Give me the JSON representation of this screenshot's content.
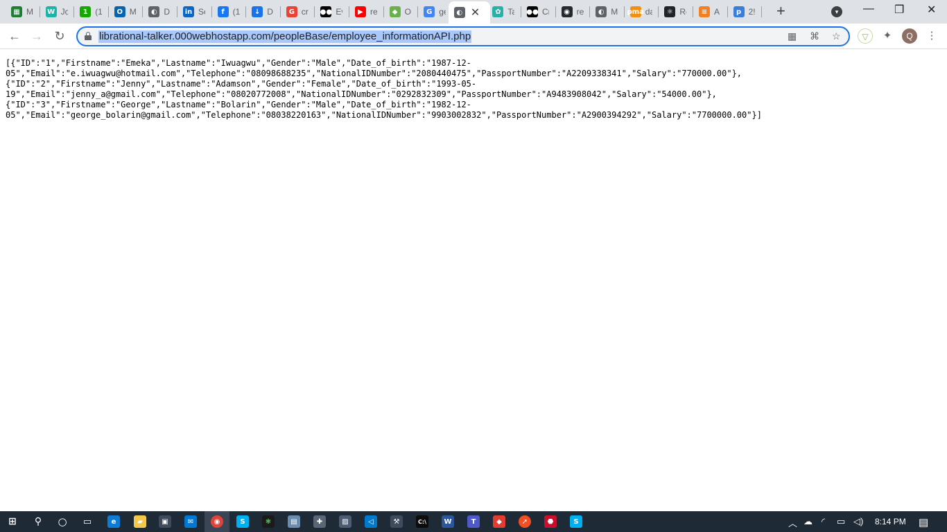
{
  "browser": {
    "tabs": [
      {
        "label": "M",
        "icon": "sheets-icon",
        "color": "#1e7e34",
        "glyph": "▦"
      },
      {
        "label": "Jc",
        "icon": "workana-icon",
        "color": "#1fb3a8",
        "glyph": "W"
      },
      {
        "label": "(1",
        "icon": "upwork-icon",
        "color": "#14a800",
        "glyph": "1"
      },
      {
        "label": "M",
        "icon": "outlook-icon",
        "color": "#0a64ad",
        "glyph": "O"
      },
      {
        "label": "D",
        "icon": "globe-icon",
        "color": "#5f6368",
        "glyph": "◐"
      },
      {
        "label": "Se",
        "icon": "linkedin-icon",
        "color": "#0a66c2",
        "glyph": "in"
      },
      {
        "label": "(1",
        "icon": "facebook-icon",
        "color": "#1877f2",
        "glyph": "f"
      },
      {
        "label": "D",
        "icon": "download-icon",
        "color": "#1a73e8",
        "glyph": "↓"
      },
      {
        "label": "cr",
        "icon": "google-icon",
        "color": "#ea4335",
        "glyph": "G"
      },
      {
        "label": "Ev",
        "icon": "medium-icon",
        "color": "#000000",
        "glyph": "●●"
      },
      {
        "label": "re",
        "icon": "youtube-icon",
        "color": "#ff0000",
        "glyph": "▶"
      },
      {
        "label": "O",
        "icon": "android-icon",
        "color": "#6ab04c",
        "glyph": "◆"
      },
      {
        "label": "ge",
        "icon": "google-icon",
        "color": "#4285f4",
        "glyph": "G"
      },
      {
        "label": "",
        "icon": "globe-icon",
        "color": "#5f6368",
        "glyph": "◐",
        "active": true
      },
      {
        "label": "Ta",
        "icon": "tailwind-icon",
        "color": "#2bb0a8",
        "glyph": "✿"
      },
      {
        "label": "Cr",
        "icon": "medium-icon",
        "color": "#000000",
        "glyph": "●●"
      },
      {
        "label": "re",
        "icon": "github-icon",
        "color": "#24292e",
        "glyph": "◉"
      },
      {
        "label": "M",
        "icon": "globe-icon",
        "color": "#5f6368",
        "glyph": "◐"
      },
      {
        "label": "da",
        "icon": "pma-icon",
        "color": "#f29111",
        "glyph": "pma"
      },
      {
        "label": "Re",
        "icon": "react-icon",
        "color": "#20232a",
        "glyph": "⚛"
      },
      {
        "label": "A",
        "icon": "stackoverflow-icon",
        "color": "#f48024",
        "glyph": "≡"
      },
      {
        "label": "2!",
        "icon": "p-icon",
        "color": "#3b7ddd",
        "glyph": "p"
      }
    ],
    "url": "librational-talker.000webhostapp.com/peopleBase/employee_informationAPI.php",
    "profile_initial": "Q"
  },
  "page": {
    "json_text": "[{\"ID\":\"1\",\"Firstname\":\"Emeka\",\"Lastname\":\"Iwuagwu\",\"Gender\":\"Male\",\"Date_of_birth\":\"1987-12-\n05\",\"Email\":\"e.iwuagwu@hotmail.com\",\"Telephone\":\"08098688235\",\"NationalIDNumber\":\"2080440475\",\"PassportNumber\":\"A2209338341\",\"Salary\":\"770000.00\"},\n{\"ID\":\"2\",\"Firstname\":\"Jenny\",\"Lastname\":\"Adamson\",\"Gender\":\"Female\",\"Date_of_birth\":\"1993-05-\n19\",\"Email\":\"jenny_a@gmail.com\",\"Telephone\":\"08020772008\",\"NationalIDNumber\":\"0292832309\",\"PassportNumber\":\"A9483908042\",\"Salary\":\"54000.00\"},\n{\"ID\":\"3\",\"Firstname\":\"George\",\"Lastname\":\"Bolarin\",\"Gender\":\"Male\",\"Date_of_birth\":\"1982-12-\n05\",\"Email\":\"george_bolarin@gmail.com\",\"Telephone\":\"08038220163\",\"NationalIDNumber\":\"9903002832\",\"PassportNumber\":\"A2900394292\",\"Salary\":\"7700000.00\"}]"
  },
  "taskbar": {
    "time": "8:14 PM"
  }
}
